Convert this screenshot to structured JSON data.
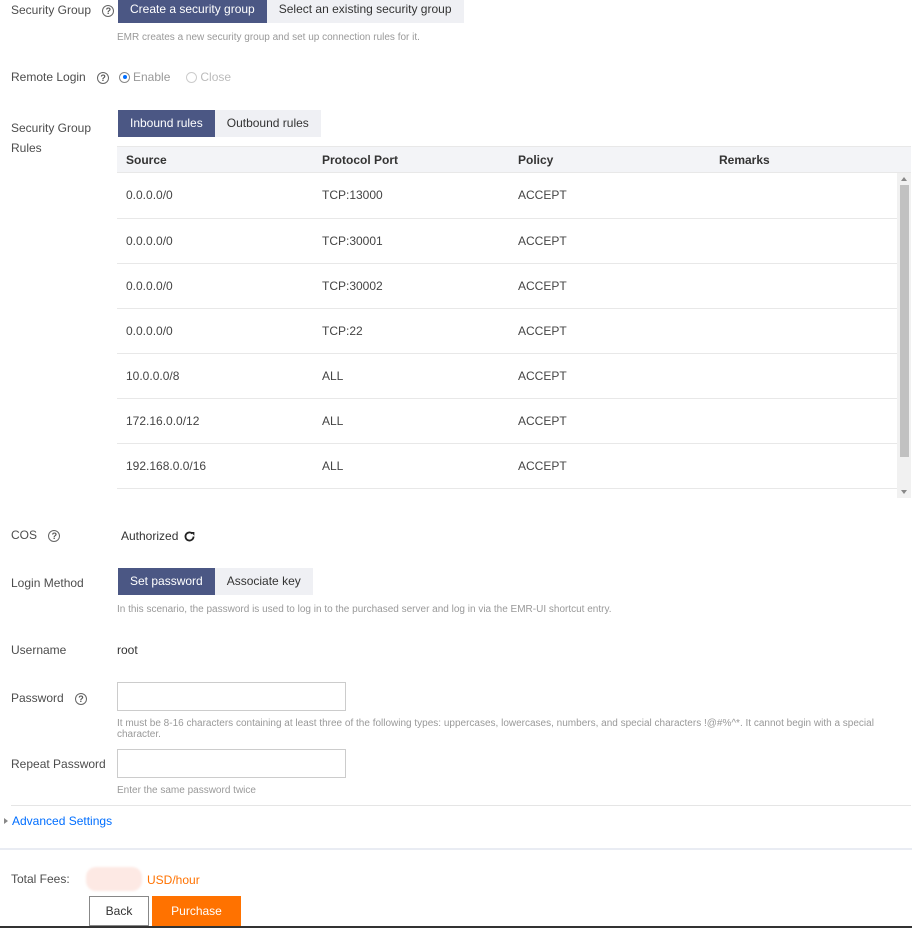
{
  "security_group": {
    "label": "Security Group",
    "tabs": [
      "Create a security group",
      "Select an existing security group"
    ],
    "hint": "EMR creates a new security group and set up connection rules for it."
  },
  "remote_login": {
    "label": "Remote Login",
    "options": [
      "Enable",
      "Close"
    ],
    "selected": "Enable"
  },
  "rules": {
    "label_line1": "Security Group",
    "label_line2": "Rules",
    "tabs": [
      "Inbound rules",
      "Outbound rules"
    ],
    "columns": [
      "Source",
      "Protocol Port",
      "Policy",
      "Remarks"
    ],
    "rows": [
      {
        "source": "0.0.0.0/0",
        "port": "TCP:13000",
        "policy": "ACCEPT",
        "remarks": ""
      },
      {
        "source": "0.0.0.0/0",
        "port": "TCP:30001",
        "policy": "ACCEPT",
        "remarks": ""
      },
      {
        "source": "0.0.0.0/0",
        "port": "TCP:30002",
        "policy": "ACCEPT",
        "remarks": ""
      },
      {
        "source": "0.0.0.0/0",
        "port": "TCP:22",
        "policy": "ACCEPT",
        "remarks": ""
      },
      {
        "source": "10.0.0.0/8",
        "port": "ALL",
        "policy": "ACCEPT",
        "remarks": ""
      },
      {
        "source": "172.16.0.0/12",
        "port": "ALL",
        "policy": "ACCEPT",
        "remarks": ""
      },
      {
        "source": "192.168.0.0/16",
        "port": "ALL",
        "policy": "ACCEPT",
        "remarks": ""
      }
    ]
  },
  "cos": {
    "label": "COS",
    "status": "Authorized",
    "refresh_icon": "refresh-icon"
  },
  "login_method": {
    "label": "Login Method",
    "tabs": [
      "Set password",
      "Associate key"
    ],
    "hint": "In this scenario, the password is used to log in to the purchased server and log in via the EMR-UI shortcut entry."
  },
  "username": {
    "label": "Username",
    "value": "root"
  },
  "password": {
    "label": "Password",
    "value": "",
    "hint": "It must be 8-16 characters containing at least three of the following types: uppercases, lowercases, numbers, and special characters !@#%^*. It cannot begin with a special character."
  },
  "repeat_password": {
    "label": "Repeat Password",
    "value": "",
    "hint": "Enter the same password twice"
  },
  "advanced": {
    "label": "Advanced Settings"
  },
  "footer": {
    "fees_label": "Total Fees:",
    "fees_unit": "USD/hour",
    "back_label": "Back",
    "purchase_label": "Purchase"
  },
  "colors": {
    "accent": "#4b5784",
    "link": "#006eff",
    "orange": "#ff7200"
  }
}
